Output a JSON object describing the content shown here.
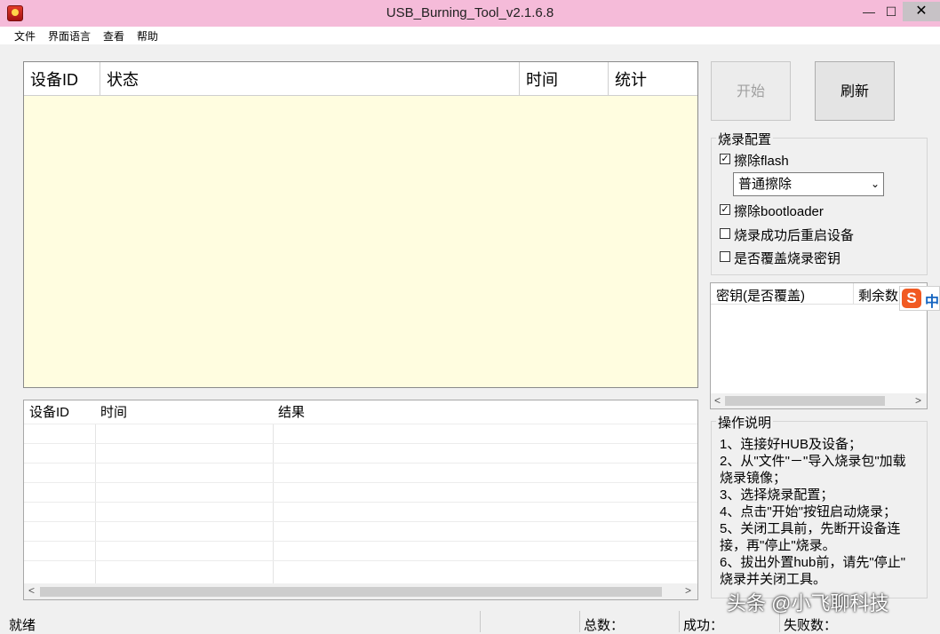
{
  "window": {
    "title": "USB_Burning_Tool_v2.1.6.8",
    "minimize": "—",
    "maximize": "☐",
    "close": "✕"
  },
  "menu": [
    "文件",
    "界面语言",
    "查看",
    "帮助"
  ],
  "device_table": {
    "columns": [
      "设备ID",
      "状态",
      "时间",
      "统计"
    ]
  },
  "result_table": {
    "columns": [
      "设备ID",
      "时间",
      "结果"
    ],
    "scroll_left": "<",
    "scroll_right": ">"
  },
  "buttons": {
    "start": "开始",
    "refresh": "刷新"
  },
  "burn_config": {
    "title": "烧录配置",
    "erase_flash": {
      "label": "擦除flash",
      "checked": true
    },
    "erase_mode": "普通擦除",
    "erase_bootloader": {
      "label": "擦除bootloader",
      "checked": true
    },
    "reboot_after": {
      "label": "烧录成功后重启设备",
      "checked": false
    },
    "overwrite_key": {
      "label": "是否覆盖烧录密钥",
      "checked": false
    }
  },
  "key_table": {
    "columns": [
      "密钥(是否覆盖)",
      "剩余数"
    ]
  },
  "ime": {
    "logo": "S",
    "mode": "中"
  },
  "instructions": {
    "title": "操作说明",
    "lines": [
      "1、连接好HUB及设备；",
      "2、从\"文件\"－\"导入烧录包\"加载",
      "烧录镜像；",
      "3、选择烧录配置；",
      "4、点击\"开始\"按钮启动烧录；",
      "5、关闭工具前，先断开设备连",
      "接，再\"停止\"烧录。",
      "6、拔出外置hub前，请先\"停止\"",
      "烧录并关闭工具。"
    ]
  },
  "status_bar": {
    "state": "就绪",
    "total_label": "总数：",
    "success_label": "成功：",
    "fail_label": "失败数："
  },
  "watermark": "头条 @小飞聊科技",
  "colors": {
    "titlebar": "#f5bbd9",
    "device_list_bg": "#fffde0",
    "ime_orange": "#f15a22"
  }
}
